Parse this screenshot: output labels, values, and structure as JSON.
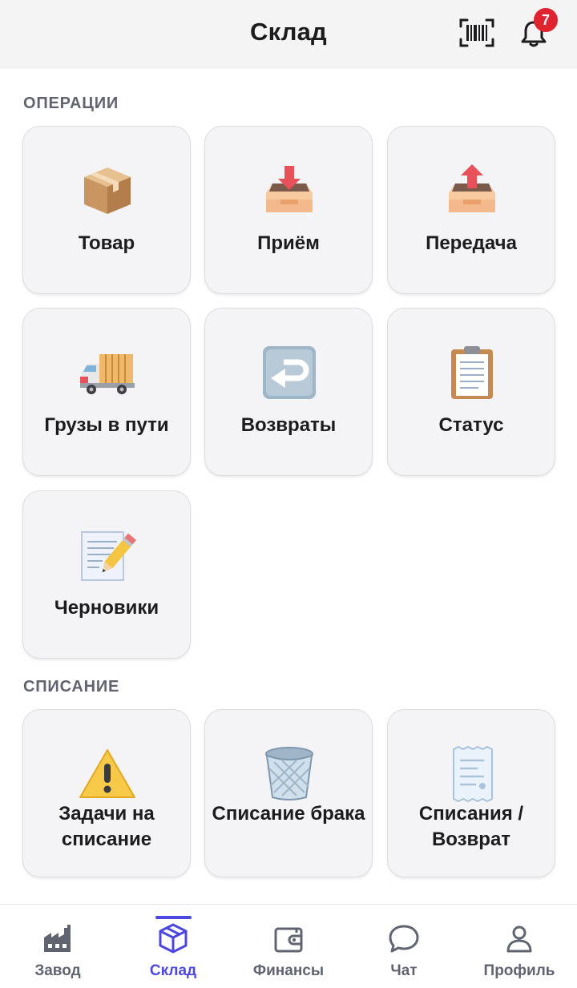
{
  "header": {
    "title": "Склад",
    "barcode_icon": "barcode-scan-icon",
    "bell_icon": "bell-icon",
    "notification_count": "7"
  },
  "sections": {
    "operations": {
      "title": "ОПЕРАЦИИ",
      "items": [
        {
          "label": "Товар",
          "icon": "package-icon"
        },
        {
          "label": "Приём",
          "icon": "inbox-in-icon"
        },
        {
          "label": "Передача",
          "icon": "outbox-icon"
        },
        {
          "label": "Грузы в пути",
          "icon": "delivery-truck-icon"
        },
        {
          "label": "Возвраты",
          "icon": "return-arrow-icon"
        },
        {
          "label": "Статус",
          "icon": "clipboard-icon"
        },
        {
          "label": "Черновики",
          "icon": "memo-pencil-icon"
        }
      ]
    },
    "writeoff": {
      "title": "СПИСАНИЕ",
      "items": [
        {
          "label": "Задачи на списание",
          "icon": "warning-icon"
        },
        {
          "label": "Списание брака",
          "icon": "wastebasket-icon"
        },
        {
          "label": "Списания / Возврат",
          "icon": "receipt-icon"
        }
      ]
    }
  },
  "tabbar": {
    "items": [
      {
        "label": "Завод",
        "icon": "factory-icon",
        "active": false
      },
      {
        "label": "Склад",
        "icon": "cube-icon",
        "active": true
      },
      {
        "label": "Финансы",
        "icon": "wallet-icon",
        "active": false
      },
      {
        "label": "Чат",
        "icon": "chat-bubble-icon",
        "active": false
      },
      {
        "label": "Профиль",
        "icon": "user-icon",
        "active": false
      }
    ]
  },
  "colors": {
    "accent": "#4d47e0",
    "badge": "#e0242f",
    "tile_bg": "#f4f4f6",
    "header_bg": "#f4f4f5",
    "muted_text": "#5f6470"
  }
}
